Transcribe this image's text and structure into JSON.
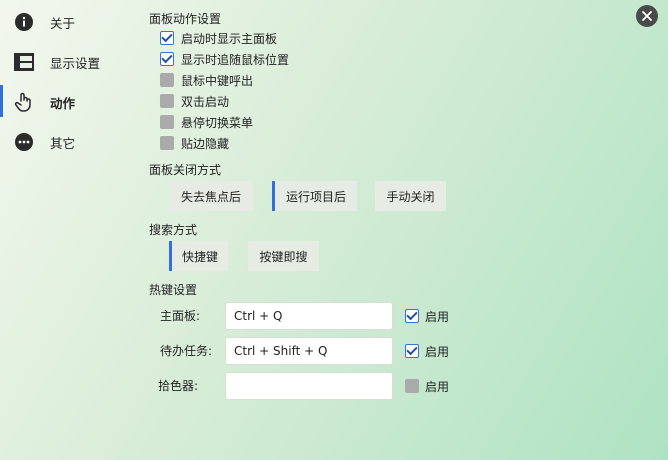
{
  "sidebar": {
    "items": [
      {
        "label": "关于",
        "icon": "info-icon"
      },
      {
        "label": "显示设置",
        "icon": "layout-icon"
      },
      {
        "label": "动作",
        "icon": "pointer-hand-icon",
        "active": true
      },
      {
        "label": "其它",
        "icon": "more-icon"
      }
    ]
  },
  "panel_actions": {
    "title": "面板动作设置",
    "options": [
      {
        "label": "启动时显示主面板",
        "checked": true
      },
      {
        "label": "显示时追随鼠标位置",
        "checked": true
      },
      {
        "label": "鼠标中键呼出",
        "checked": false
      },
      {
        "label": "双击启动",
        "checked": false
      },
      {
        "label": "悬停切换菜单",
        "checked": false
      },
      {
        "label": "贴边隐藏",
        "checked": false
      }
    ]
  },
  "close_mode": {
    "title": "面板关闭方式",
    "options": [
      "失去焦点后",
      "运行项目后",
      "手动关闭"
    ],
    "selected": "运行项目后"
  },
  "search_mode": {
    "title": "搜索方式",
    "options": [
      "快捷键",
      "按键即搜"
    ],
    "selected": "快捷键"
  },
  "hotkeys": {
    "title": "热键设置",
    "enable_label": "启用",
    "rows": [
      {
        "label": "主面板:",
        "value": "Ctrl + Q",
        "enabled": true
      },
      {
        "label": "待办任务:",
        "value": "Ctrl + Shift + Q",
        "enabled": true
      },
      {
        "label": "拾色器:",
        "value": "",
        "enabled": false
      }
    ]
  },
  "colors": {
    "accent": "#2f6fe0",
    "checkbox_off": "#a9aaa9",
    "button_bg": "#e6ece4"
  }
}
